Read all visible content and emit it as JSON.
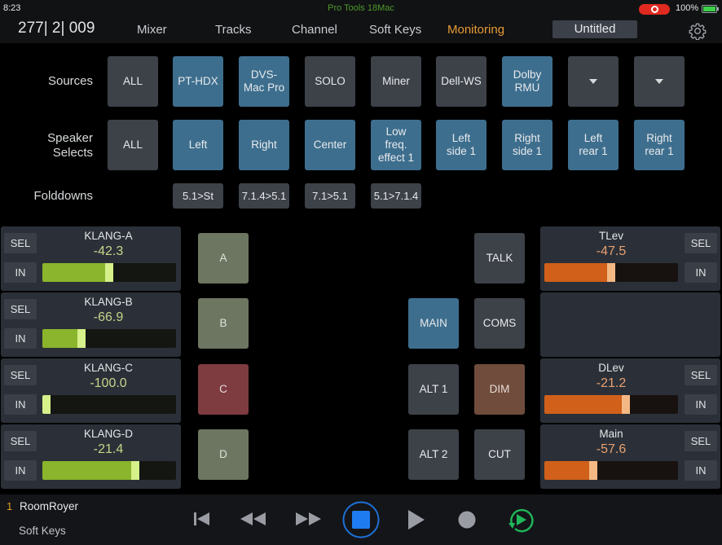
{
  "status_bar": {
    "time": "8:23",
    "app_name": "Pro Tools 18Mac",
    "battery_percent": "100%",
    "recording_indicator": "screen-record-icon"
  },
  "nav": {
    "counter": "277| 2| 009",
    "tabs": [
      {
        "label": "Mixer",
        "active": false
      },
      {
        "label": "Tracks",
        "active": false
      },
      {
        "label": "Channel",
        "active": false
      },
      {
        "label": "Soft Keys",
        "active": false
      },
      {
        "label": "Monitoring",
        "active": true
      }
    ],
    "session_title": "Untitled",
    "settings_icon": "gear-icon"
  },
  "sources": {
    "label": "Sources",
    "buttons": [
      {
        "label": "ALL",
        "state": "off"
      },
      {
        "label": "PT-HDX",
        "state": "on"
      },
      {
        "label": "DVS-\nMac Pro",
        "state": "on"
      },
      {
        "label": "SOLO",
        "state": "off"
      },
      {
        "label": "Miner",
        "state": "off"
      },
      {
        "label": "Dell-WS",
        "state": "off"
      },
      {
        "label": "Dolby\nRMU",
        "state": "on"
      },
      {
        "label": "",
        "state": "off",
        "icon": "dropdown-triangle-icon"
      },
      {
        "label": "",
        "state": "off",
        "icon": "dropdown-triangle-icon"
      }
    ]
  },
  "speaker_selects": {
    "label": "Speaker\nSelects",
    "buttons": [
      {
        "label": "ALL",
        "state": "off"
      },
      {
        "label": "Left",
        "state": "on"
      },
      {
        "label": "Right",
        "state": "on"
      },
      {
        "label": "Center",
        "state": "on"
      },
      {
        "label": "Low\nfreq.\neffect 1",
        "state": "on"
      },
      {
        "label": "Left\nside 1",
        "state": "on"
      },
      {
        "label": "Right\nside 1",
        "state": "on"
      },
      {
        "label": "Left\nrear 1",
        "state": "on"
      },
      {
        "label": "Right\nrear 1",
        "state": "on"
      }
    ]
  },
  "folddowns": {
    "label": "Folddowns",
    "buttons": [
      "5.1>St",
      "7.1.4>5.1",
      "7.1>5.1",
      "5.1>7.1.4"
    ]
  },
  "input_strips": [
    {
      "name": "KLANG-A",
      "value": "-42.3",
      "meter_fraction": 0.5,
      "sel": "SEL",
      "in": "IN"
    },
    {
      "name": "KLANG-B",
      "value": "-66.9",
      "meter_fraction": 0.28,
      "sel": "SEL",
      "in": "IN"
    },
    {
      "name": "KLANG-C",
      "value": "-100.0",
      "meter_fraction": 0.0,
      "sel": "SEL",
      "in": "IN"
    },
    {
      "name": "KLANG-D",
      "value": "-21.4",
      "meter_fraction": 0.71,
      "sel": "SEL",
      "in": "IN"
    }
  ],
  "cue_buttons": [
    {
      "label": "A",
      "color": "olive"
    },
    {
      "label": "B",
      "color": "olive"
    },
    {
      "label": "C",
      "color": "red"
    },
    {
      "label": "D",
      "color": "olive"
    }
  ],
  "output_buttons": {
    "talk": "TALK",
    "main": "MAIN",
    "coms": "COMS",
    "alt1": "ALT 1",
    "dim": "DIM",
    "alt2": "ALT 2",
    "cut": "CUT"
  },
  "output_strips": [
    {
      "name": "TLev",
      "value": "-47.5",
      "meter_fraction": 0.5,
      "sel": "SEL",
      "in": "IN"
    },
    {
      "name": "DLev",
      "value": "-21.2",
      "meter_fraction": 0.62,
      "sel": "SEL",
      "in": "IN"
    },
    {
      "name": "Main",
      "value": "-57.6",
      "meter_fraction": 0.36,
      "sel": "SEL",
      "in": "IN"
    }
  ],
  "bottom_bar": {
    "layout_number": "1",
    "layout_name": "RoomRoyer",
    "page_label": "Soft Keys",
    "transport": [
      "go-to-start-icon",
      "rewind-icon",
      "fast-forward-icon",
      "stop-icon",
      "play-icon",
      "record-icon",
      "loop-playback-icon"
    ]
  },
  "colors": {
    "active_tab": "#e69a34",
    "selected_button": "#3d6e8e",
    "input_meter": "#8ab52c",
    "output_meter": "#d0601a",
    "stop_button": "#1e7cf0",
    "loop_icon": "#1fb85a"
  }
}
